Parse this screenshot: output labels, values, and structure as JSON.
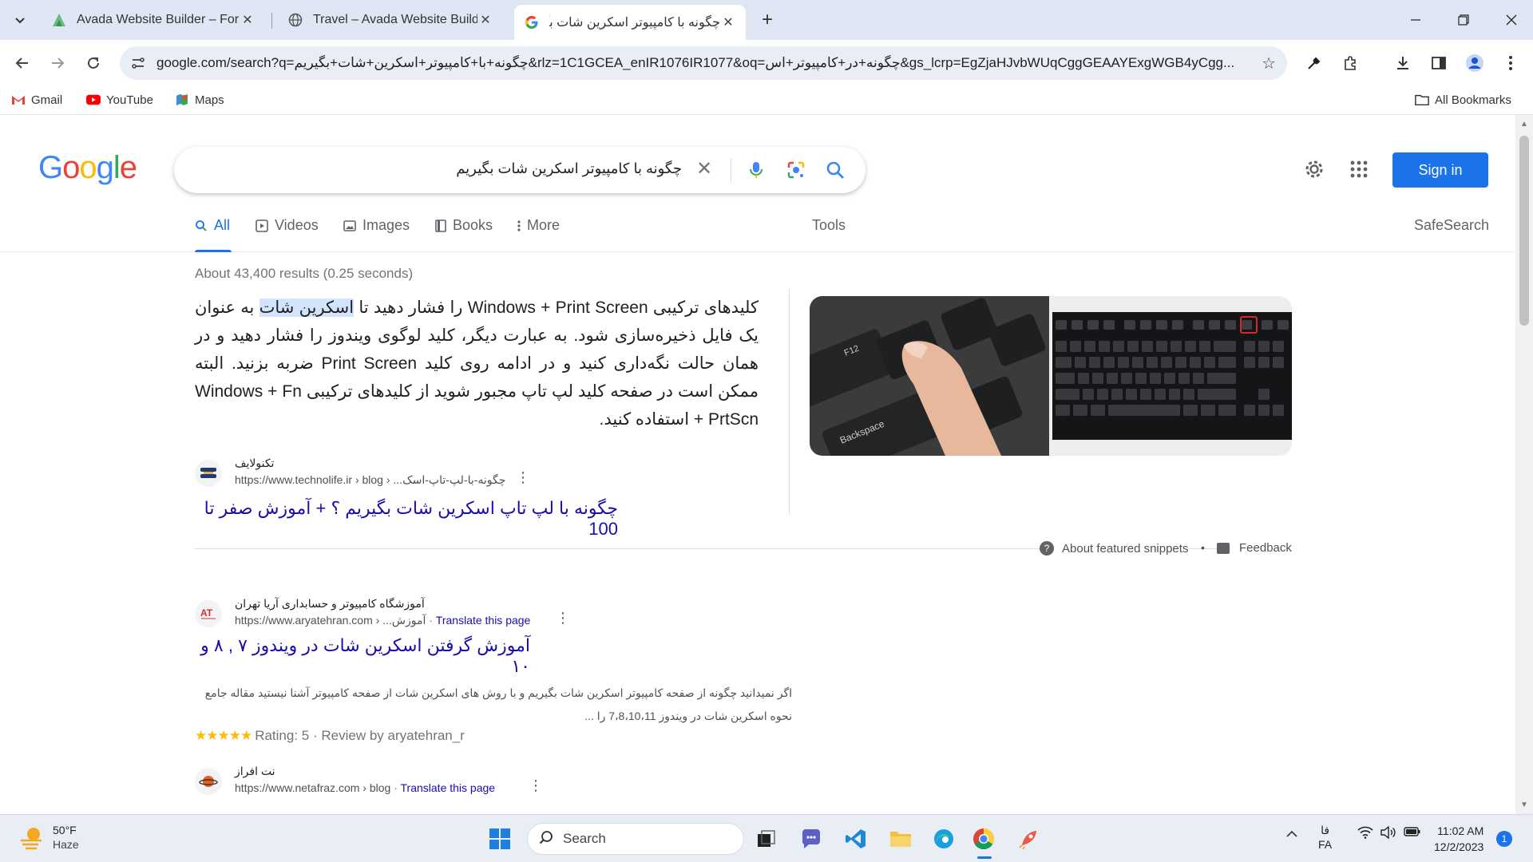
{
  "browser": {
    "tabs": [
      {
        "title": "Avada Website Builder – For W",
        "favicon": "avada-icon"
      },
      {
        "title": "Travel – Avada Website Builder",
        "favicon": "globe-icon"
      },
      {
        "title": "چگونه با کامپیوتر اسکرین شات بگ",
        "favicon": "google-g-icon",
        "active": true
      }
    ],
    "url": "google.com/search?q=چگونه+با+کامپیوتر+اسکرین+شات+بگیریم&rlz=1C1GCEA_enIR1076IR1077&oq=چگونه+در+کامپیوتر+اس&gs_lcrp=EgZjaHJvbWUqCggGEAAYExgWGB4yCgg...",
    "bookmarks": [
      {
        "label": "Gmail",
        "icon": "gmail-icon"
      },
      {
        "label": "YouTube",
        "icon": "youtube-icon"
      },
      {
        "label": "Maps",
        "icon": "maps-icon"
      }
    ],
    "all_bookmarks": "All Bookmarks"
  },
  "google": {
    "logo": "Google",
    "query": "چگونه با کامپیوتر اسکرین شات بگیریم",
    "sign_in": "Sign in",
    "tabs": {
      "all": "All",
      "videos": "Videos",
      "images": "Images",
      "books": "Books",
      "more": "More",
      "tools": "Tools",
      "safesearch": "SafeSearch"
    },
    "stats": "About 43,400 results (0.25 seconds)",
    "featured": {
      "text_before": "کلیدهای ترکیبی Windows + Print Screen را فشار دهید تا ",
      "text_highlight": "اسکرین شات",
      "text_after": " به عنوان یک فایل ذخیره‌سازی شود. به عبارت دیگر، کلید لوگوی ویندوز را فشار دهید و در همان حالت نگه‌داری کنید و در ادامه روی کلید Print Screen ضربه بزنید. البته ممکن است در صفحه کلید لپ تاپ مجبور شوید از کلیدهای ترکیبی Windows + Fn + PrtScn استفاده کنید.",
      "site_name": "تکنولایف",
      "url": "https://www.technolife.ir › blog › ...چگونه-با-لپ-تاپ-اسک",
      "title": "چگونه با لپ تاپ اسکرین شات بگیریم ؟ + آموزش صفر تا 100",
      "about": "About featured snippets",
      "dot": "•",
      "feedback": "Feedback"
    },
    "results": [
      {
        "site_name": "آموزشگاه کامپیوتر و حسابداری آریا تهران",
        "favicon_text": "AT",
        "url": "https://www.aryatehran.com › ...آموزش",
        "translate": "Translate this page",
        "title": "آموزش گرفتن اسکرین شات در ویندوز ۷ , ۸ و ۱۰",
        "snippet_line1": "اگر نمیدانید چگونه از صفحه کامپیوتر اسکرین شات بگیریم و با روش های اسکرین شات از صفحه کامپیوتر آشنا نیستید مقاله جامع",
        "snippet_line2": "نحوه اسکرین شات در ویندوز 7،8،10،11 را ...",
        "stars": "★★★★★",
        "rating": "Rating: 5 · Review by aryatehran_r"
      },
      {
        "site_name": "نت افراز",
        "url": "https://www.netafraz.com › blog",
        "translate": "Translate this page"
      }
    ]
  },
  "taskbar": {
    "weather_temp": "50°F",
    "weather_cond": "Haze",
    "search_label": "Search",
    "lang_top": "فا",
    "lang_bottom": "FA",
    "time": "11:02 AM",
    "date": "12/2/2023",
    "notifications": "1"
  },
  "colors": {
    "accent": "#1a73e8",
    "link": "#1a0dab",
    "tabbar": "#dfe7f4",
    "taskbar": "#e9eef5"
  }
}
